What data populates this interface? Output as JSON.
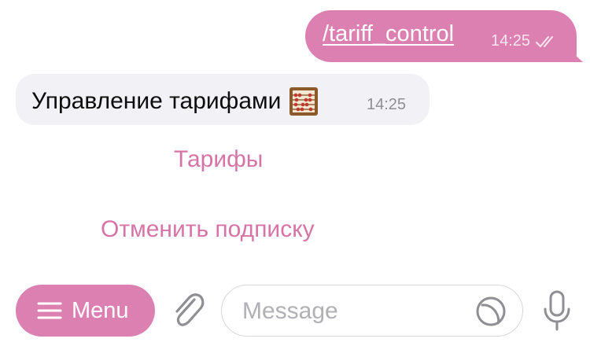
{
  "chat": {
    "outgoing": {
      "text": "/tariff_control",
      "time": "14:25",
      "status_icon": "double-check-icon"
    },
    "incoming": {
      "text": "Управление тарифами",
      "emoji_icon": "abacus-icon",
      "time": "14:25"
    },
    "inline_buttons": [
      {
        "label": "Тарифы"
      },
      {
        "label": "Отменить подписку"
      }
    ]
  },
  "input_bar": {
    "menu_label": "Menu",
    "menu_icon": "hamburger-icon",
    "attach_icon": "paperclip-icon",
    "message_placeholder": "Message",
    "sticker_icon": "sticker-icon",
    "mic_icon": "microphone-icon"
  },
  "colors": {
    "accent": "#dc80b1",
    "accent_text": "#d774a7",
    "incoming_bubble": "#f2f2f6",
    "meta_gray": "#8e8e93"
  }
}
